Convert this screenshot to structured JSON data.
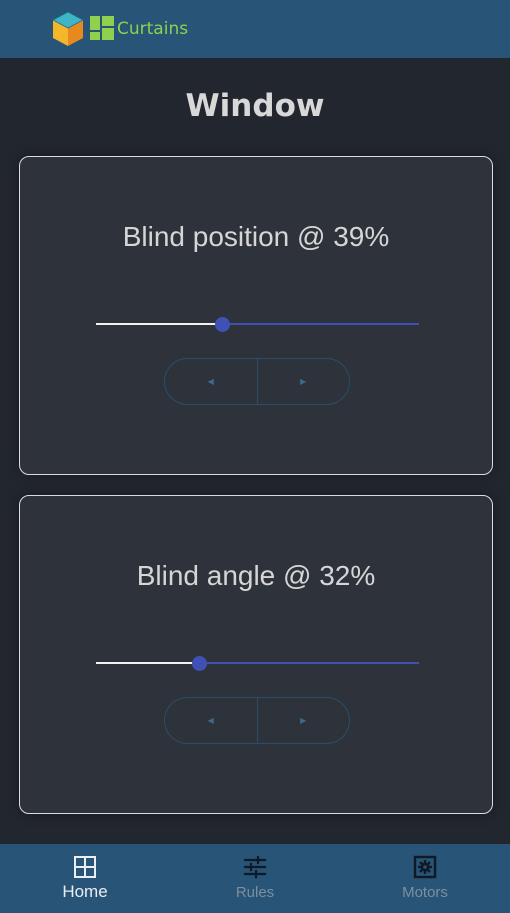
{
  "app": {
    "brand": "Curtains"
  },
  "page": {
    "title": "Window"
  },
  "controls": [
    {
      "label": "Blind position @ 39%",
      "value": 39,
      "decrease_icon": "caret-left-icon",
      "increase_icon": "caret-right-icon"
    },
    {
      "label": "Blind angle @ 32%",
      "value": 32,
      "decrease_icon": "caret-left-icon",
      "increase_icon": "caret-right-icon"
    }
  ],
  "nav": {
    "items": [
      {
        "label": "Home",
        "icon": "grid-icon",
        "active": true
      },
      {
        "label": "Rules",
        "icon": "sliders-icon",
        "active": false
      },
      {
        "label": "Motors",
        "icon": "cog-box-icon",
        "active": false
      }
    ]
  },
  "colors": {
    "topbar": "#285477",
    "background": "#22262e",
    "card": "#2d323b",
    "accent": "#3f51b5",
    "brand": "#8fd14f"
  }
}
